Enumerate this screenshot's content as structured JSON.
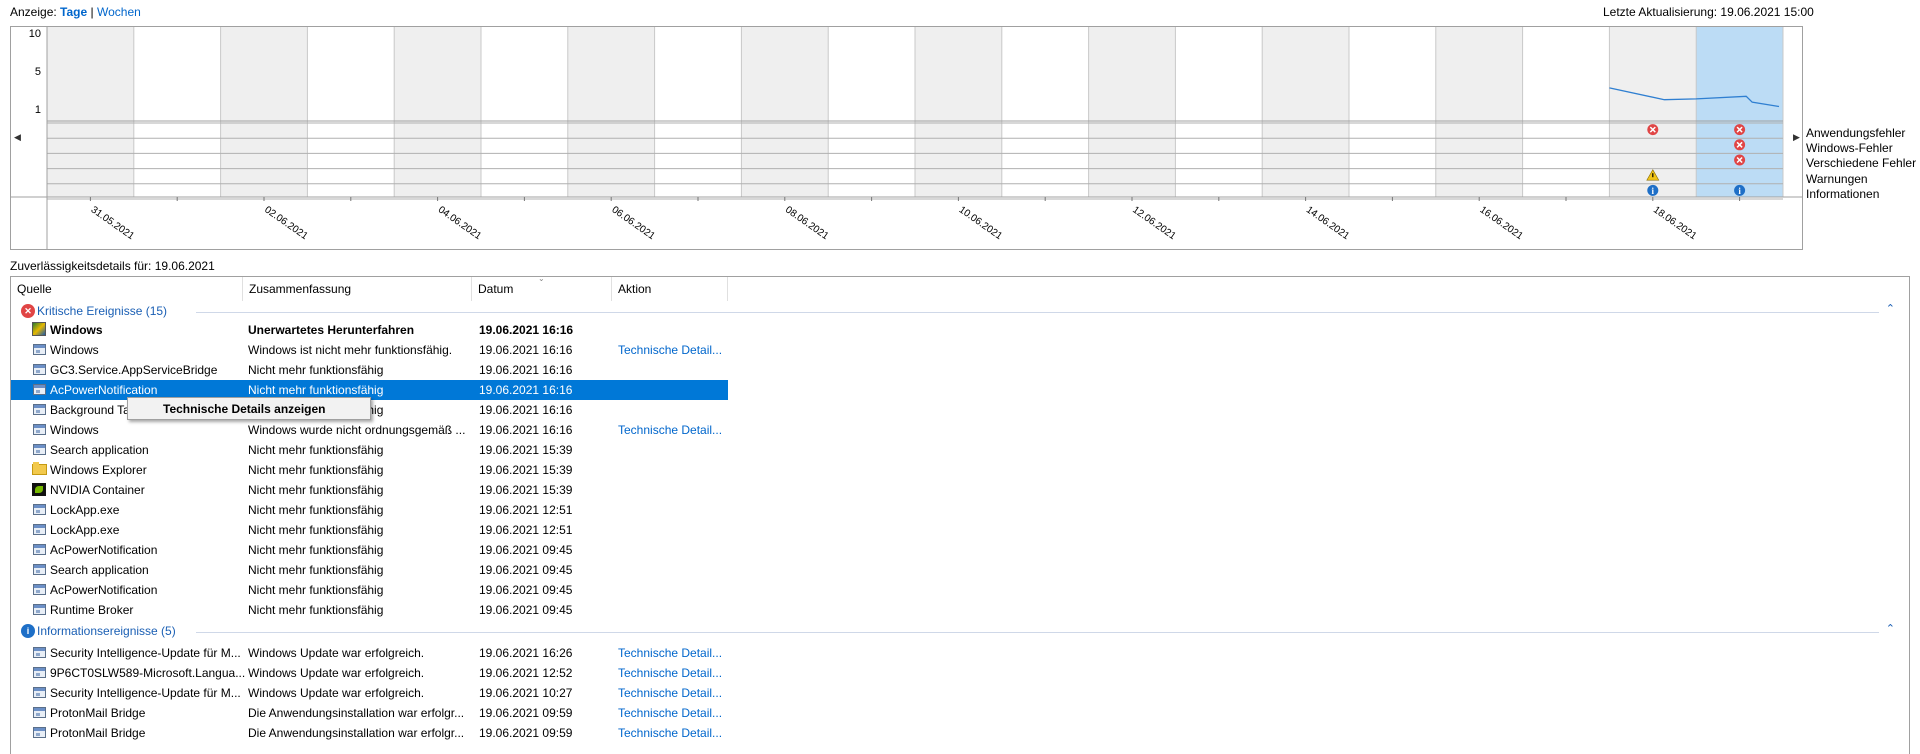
{
  "view_toggle": {
    "prefix": "Anzeige:",
    "days": "Tage",
    "sep": "|",
    "weeks": "Wochen"
  },
  "last_update": "Letzte Aktualisierung: 19.06.2021 15:00",
  "chart": {
    "y_ticks": [
      "10",
      "5",
      "1"
    ],
    "dates": [
      "31.05.2021",
      "02.06.2021",
      "04.06.2021",
      "06.06.2021",
      "08.06.2021",
      "10.06.2021",
      "12.06.2021",
      "14.06.2021",
      "16.06.2021",
      "18.06.2021"
    ],
    "legend": [
      "Anwendungsfehler",
      "Windows-Fehler",
      "Verschiedene Fehler",
      "Warnungen",
      "Informationen"
    ],
    "selected_day": "19.06.2021",
    "colors": {
      "selected": "#bcdcf5",
      "shade": "#efefef",
      "line": "#2f7fd1",
      "error": "#e04545",
      "warning": "#f0c419",
      "info": "#1e6fc7"
    }
  },
  "chart_data": {
    "type": "line",
    "title": "",
    "xlabel": "",
    "ylabel": "",
    "ylim": [
      1,
      10
    ],
    "x": [
      "18.06.2021",
      "18.06.2021",
      "19.06.2021",
      "19.06.2021",
      "19.06.2021",
      "19.06.2021"
    ],
    "series": [
      {
        "values": [
          3.5,
          2.1,
          2.2,
          2.5,
          1.8,
          1.3
        ]
      }
    ],
    "event_markers": {
      "18.06.2021": [
        "Anwendungsfehler",
        "Warnungen",
        "Informationen"
      ],
      "19.06.2021": [
        "Anwendungsfehler",
        "Windows-Fehler",
        "Verschiedene Fehler",
        "Informationen"
      ]
    }
  },
  "details_title": "Zuverlässigkeitsdetails für: 19.06.2021",
  "columns": [
    "Quelle",
    "Zusammenfassung",
    "Datum",
    "Aktion"
  ],
  "groups": [
    {
      "title": "Kritische Ereignisse (15)",
      "rows": [
        {
          "icon": "windows-flag-icon",
          "source": "Windows",
          "summary": "Unerwartetes Herunterfahren",
          "date": "19.06.2021 16:16",
          "action": "",
          "bold": true
        },
        {
          "icon": "app-window-icon",
          "source": "Windows",
          "summary": "Windows ist nicht mehr funktionsfähig.",
          "date": "19.06.2021 16:16",
          "action": "Technische Detail..."
        },
        {
          "icon": "app-window-icon",
          "source": "GC3.Service.AppServiceBridge",
          "summary": "Nicht mehr funktionsfähig",
          "date": "19.06.2021 16:16",
          "action": ""
        },
        {
          "icon": "app-window-icon",
          "source": "AcPowerNotification",
          "summary": "Nicht mehr funktionsfähig",
          "date": "19.06.2021 16:16",
          "action": "",
          "selected": true
        },
        {
          "icon": "app-window-icon",
          "source": "Background Task Host",
          "summary": "Nicht mehr funktionsfähig",
          "date": "19.06.2021 16:16",
          "action": ""
        },
        {
          "icon": "app-window-icon",
          "source": "Windows",
          "summary": "Windows wurde nicht ordnungsgemäß ...",
          "date": "19.06.2021 16:16",
          "action": "Technische Detail..."
        },
        {
          "icon": "app-window-icon",
          "source": "Search application",
          "summary": "Nicht mehr funktionsfähig",
          "date": "19.06.2021 15:39",
          "action": ""
        },
        {
          "icon": "folder-icon",
          "source": "Windows Explorer",
          "summary": "Nicht mehr funktionsfähig",
          "date": "19.06.2021 15:39",
          "action": ""
        },
        {
          "icon": "nvidia-icon",
          "source": "NVIDIA Container",
          "summary": "Nicht mehr funktionsfähig",
          "date": "19.06.2021 15:39",
          "action": ""
        },
        {
          "icon": "app-window-icon",
          "source": "LockApp.exe",
          "summary": "Nicht mehr funktionsfähig",
          "date": "19.06.2021 12:51",
          "action": ""
        },
        {
          "icon": "app-window-icon",
          "source": "LockApp.exe",
          "summary": "Nicht mehr funktionsfähig",
          "date": "19.06.2021 12:51",
          "action": ""
        },
        {
          "icon": "app-window-icon",
          "source": "AcPowerNotification",
          "summary": "Nicht mehr funktionsfähig",
          "date": "19.06.2021 09:45",
          "action": ""
        },
        {
          "icon": "app-window-icon",
          "source": "Search application",
          "summary": "Nicht mehr funktionsfähig",
          "date": "19.06.2021 09:45",
          "action": ""
        },
        {
          "icon": "app-window-icon",
          "source": "AcPowerNotification",
          "summary": "Nicht mehr funktionsfähig",
          "date": "19.06.2021 09:45",
          "action": ""
        },
        {
          "icon": "app-window-icon",
          "source": "Runtime Broker",
          "summary": "Nicht mehr funktionsfähig",
          "date": "19.06.2021 09:45",
          "action": ""
        }
      ]
    },
    {
      "title": "Informationsereignisse (5)",
      "rows": [
        {
          "icon": "app-window-icon",
          "source": "Security Intelligence-Update für M...",
          "summary": "Windows Update war erfolgreich.",
          "date": "19.06.2021 16:26",
          "action": "Technische Detail..."
        },
        {
          "icon": "app-window-icon",
          "source": "9P6CT0SLW589-Microsoft.Langua...",
          "summary": "Windows Update war erfolgreich.",
          "date": "19.06.2021 12:52",
          "action": "Technische Detail..."
        },
        {
          "icon": "app-window-icon",
          "source": "Security Intelligence-Update für M...",
          "summary": "Windows Update war erfolgreich.",
          "date": "19.06.2021 10:27",
          "action": "Technische Detail..."
        },
        {
          "icon": "app-window-icon",
          "source": "ProtonMail Bridge",
          "summary": "Die Anwendungsinstallation war erfolgr...",
          "date": "19.06.2021 09:59",
          "action": "Technische Detail..."
        },
        {
          "icon": "app-window-icon",
          "source": "ProtonMail Bridge",
          "summary": "Die Anwendungsinstallation war erfolgr...",
          "date": "19.06.2021 09:59",
          "action": "Technische Detail..."
        }
      ]
    }
  ],
  "context_menu": {
    "item": "Technische Details anzeigen"
  }
}
